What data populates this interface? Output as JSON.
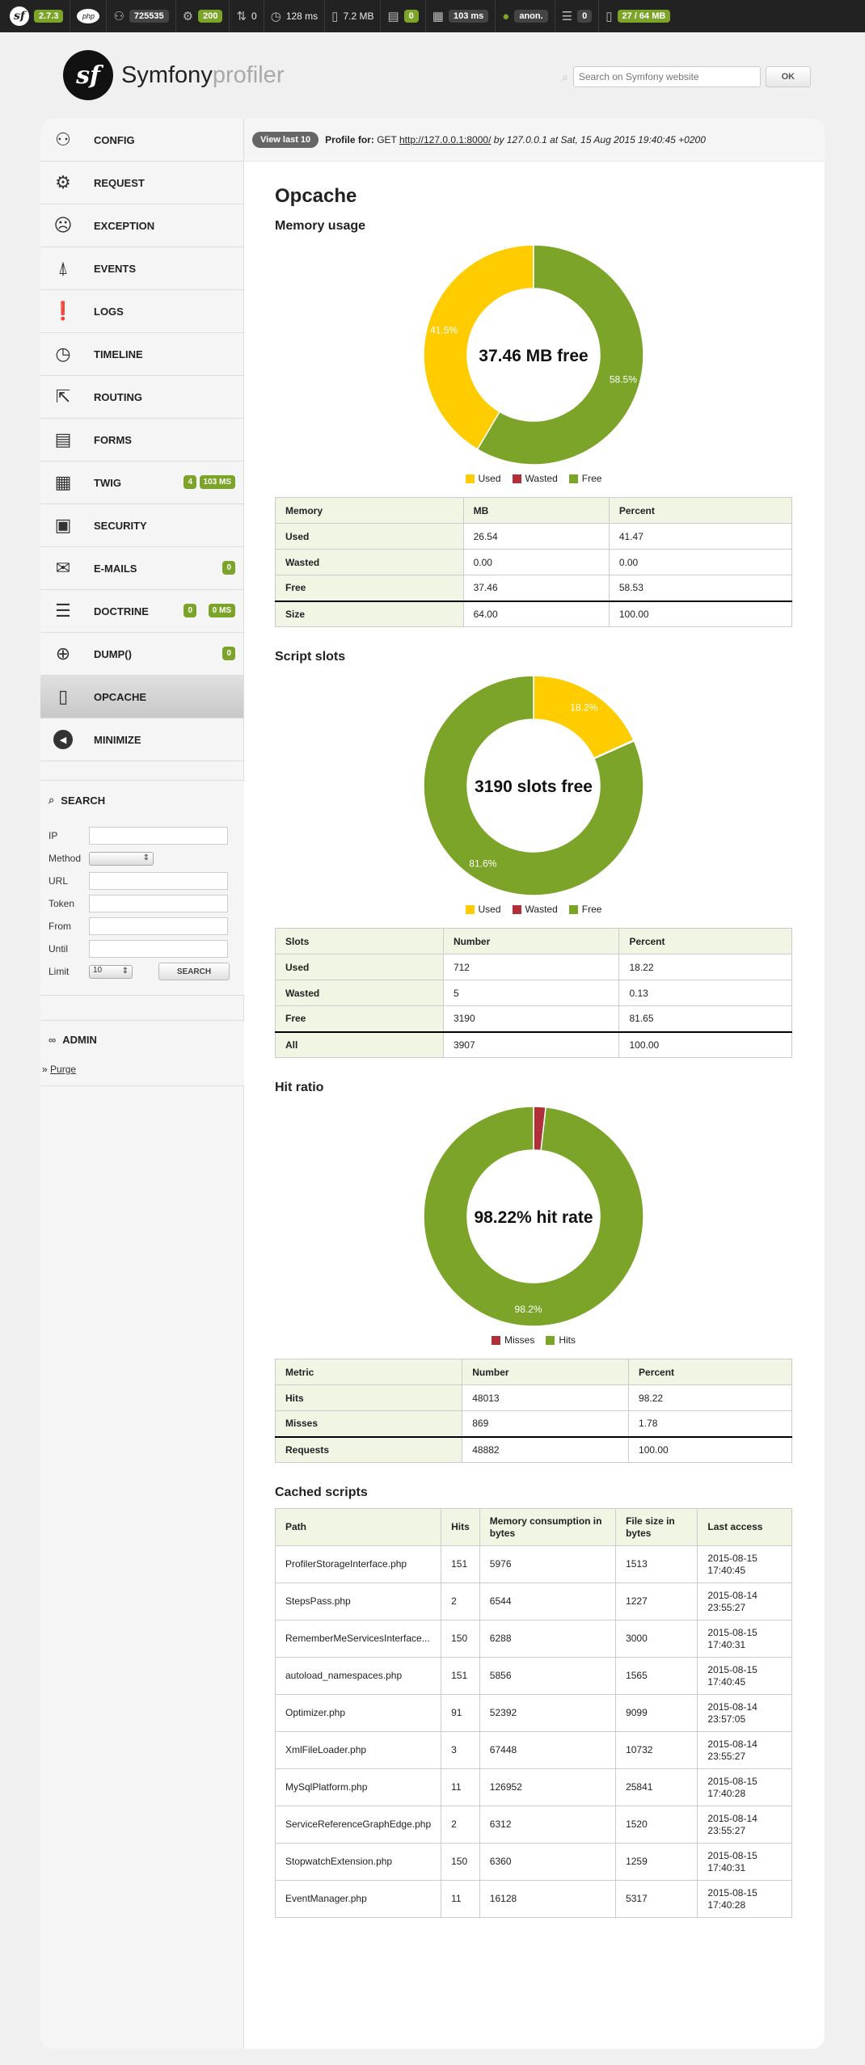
{
  "toolbar": {
    "version": "2.7.3",
    "request_id": "725535",
    "status_code": "200",
    "redirects": "0",
    "time": "128 ms",
    "memory": "7.2 MB",
    "log_count": "0",
    "twig_time": "103 ms",
    "user": "anon.",
    "queries": "0",
    "opcache": "27 / 64 MB"
  },
  "header": {
    "brand": "Symfony",
    "brand_suffix": "profiler",
    "search_placeholder": "Search on Symfony website",
    "ok_label": "OK"
  },
  "summary": {
    "view_last": "View last 10",
    "profile_for": "Profile for:",
    "method": "GET",
    "url": "http://127.0.0.1:8000/",
    "by": "by 127.0.0.1 at Sat, 15 Aug 2015 19:40:45 +0200"
  },
  "menu": [
    {
      "label": "CONFIG",
      "icon": "config-icon"
    },
    {
      "label": "REQUEST",
      "icon": "request-icon"
    },
    {
      "label": "EXCEPTION",
      "icon": "exception-icon"
    },
    {
      "label": "EVENTS",
      "icon": "events-icon"
    },
    {
      "label": "LOGS",
      "icon": "logs-icon"
    },
    {
      "label": "TIMELINE",
      "icon": "timeline-icon"
    },
    {
      "label": "ROUTING",
      "icon": "routing-icon"
    },
    {
      "label": "FORMS",
      "icon": "forms-icon"
    },
    {
      "label": "TWIG",
      "icon": "twig-icon",
      "badges": [
        "4",
        "103 MS"
      ]
    },
    {
      "label": "SECURITY",
      "icon": "security-icon"
    },
    {
      "label": "E-MAILS",
      "icon": "emails-icon",
      "badges": [
        "0"
      ]
    },
    {
      "label": "DOCTRINE",
      "icon": "doctrine-icon",
      "badges": [
        "0",
        "0 MS"
      ]
    },
    {
      "label": "DUMP()",
      "icon": "dump-icon",
      "badges": [
        "0"
      ]
    },
    {
      "label": "OPCACHE",
      "icon": "opcache-icon",
      "active": true
    },
    {
      "label": "MINIMIZE",
      "icon": "minimize-icon"
    }
  ],
  "search_panel": {
    "title": "SEARCH",
    "ip": "IP",
    "method": "Method",
    "url": "URL",
    "token": "Token",
    "from": "From",
    "until": "Until",
    "limit": "Limit",
    "limit_value": "10",
    "button": "SEARCH"
  },
  "admin_panel": {
    "title": "ADMIN",
    "purge": "Purge"
  },
  "page": {
    "title": "Opcache",
    "memory_title": "Memory usage",
    "slots_title": "Script slots",
    "hit_title": "Hit ratio",
    "cached_title": "Cached scripts"
  },
  "colors": {
    "used": "#ffcc00",
    "wasted": "#b0303a",
    "free": "#7ba428"
  },
  "legend": {
    "used": "Used",
    "wasted": "Wasted",
    "free": "Free",
    "misses": "Misses",
    "hits": "Hits"
  },
  "chart_data": [
    {
      "type": "pie",
      "title": "Memory usage",
      "center_label": "37.46 MB free",
      "slices": [
        {
          "name": "Used",
          "value": 41.47,
          "label": "41.5%"
        },
        {
          "name": "Wasted",
          "value": 0.0,
          "label": ""
        },
        {
          "name": "Free",
          "value": 58.53,
          "label": "58.5%"
        }
      ]
    },
    {
      "type": "pie",
      "title": "Script slots",
      "center_label": "3190 slots free",
      "slices": [
        {
          "name": "Used",
          "value": 18.22,
          "label": "18.2%"
        },
        {
          "name": "Wasted",
          "value": 0.13,
          "label": ""
        },
        {
          "name": "Free",
          "value": 81.65,
          "label": "81.6%"
        }
      ]
    },
    {
      "type": "pie",
      "title": "Hit ratio",
      "center_label": "98.22% hit rate",
      "slices": [
        {
          "name": "Misses",
          "value": 1.78,
          "label": ""
        },
        {
          "name": "Hits",
          "value": 98.22,
          "label": "98.2%"
        }
      ]
    }
  ],
  "memory_table": {
    "headers": [
      "Memory",
      "MB",
      "Percent"
    ],
    "rows": [
      [
        "Used",
        "26.54",
        "41.47"
      ],
      [
        "Wasted",
        "0.00",
        "0.00"
      ],
      [
        "Free",
        "37.46",
        "58.53"
      ]
    ],
    "total": [
      "Size",
      "64.00",
      "100.00"
    ]
  },
  "slots_table": {
    "headers": [
      "Slots",
      "Number",
      "Percent"
    ],
    "rows": [
      [
        "Used",
        "712",
        "18.22"
      ],
      [
        "Wasted",
        "5",
        "0.13"
      ],
      [
        "Free",
        "3190",
        "81.65"
      ]
    ],
    "total": [
      "All",
      "3907",
      "100.00"
    ]
  },
  "hit_table": {
    "headers": [
      "Metric",
      "Number",
      "Percent"
    ],
    "rows": [
      [
        "Hits",
        "48013",
        "98.22"
      ],
      [
        "Misses",
        "869",
        "1.78"
      ]
    ],
    "total": [
      "Requests",
      "48882",
      "100.00"
    ]
  },
  "scripts_table": {
    "headers": [
      "Path",
      "Hits",
      "Memory consumption in bytes",
      "File size in bytes",
      "Last access"
    ],
    "rows": [
      [
        "ProfilerStorageInterface.php",
        "151",
        "5976",
        "1513",
        "2015-08-15 17:40:45"
      ],
      [
        "StepsPass.php",
        "2",
        "6544",
        "1227",
        "2015-08-14 23:55:27"
      ],
      [
        "RememberMeServicesInterface...",
        "150",
        "6288",
        "3000",
        "2015-08-15 17:40:31"
      ],
      [
        "autoload_namespaces.php",
        "151",
        "5856",
        "1565",
        "2015-08-15 17:40:45"
      ],
      [
        "Optimizer.php",
        "91",
        "52392",
        "9099",
        "2015-08-14 23:57:05"
      ],
      [
        "XmlFileLoader.php",
        "3",
        "67448",
        "10732",
        "2015-08-14 23:55:27"
      ],
      [
        "MySqlPlatform.php",
        "11",
        "126952",
        "25841",
        "2015-08-15 17:40:28"
      ],
      [
        "ServiceReferenceGraphEdge.php",
        "2",
        "6312",
        "1520",
        "2015-08-14 23:55:27"
      ],
      [
        "StopwatchExtension.php",
        "150",
        "6360",
        "1259",
        "2015-08-15 17:40:31"
      ],
      [
        "EventManager.php",
        "11",
        "16128",
        "5317",
        "2015-08-15 17:40:28"
      ]
    ]
  }
}
